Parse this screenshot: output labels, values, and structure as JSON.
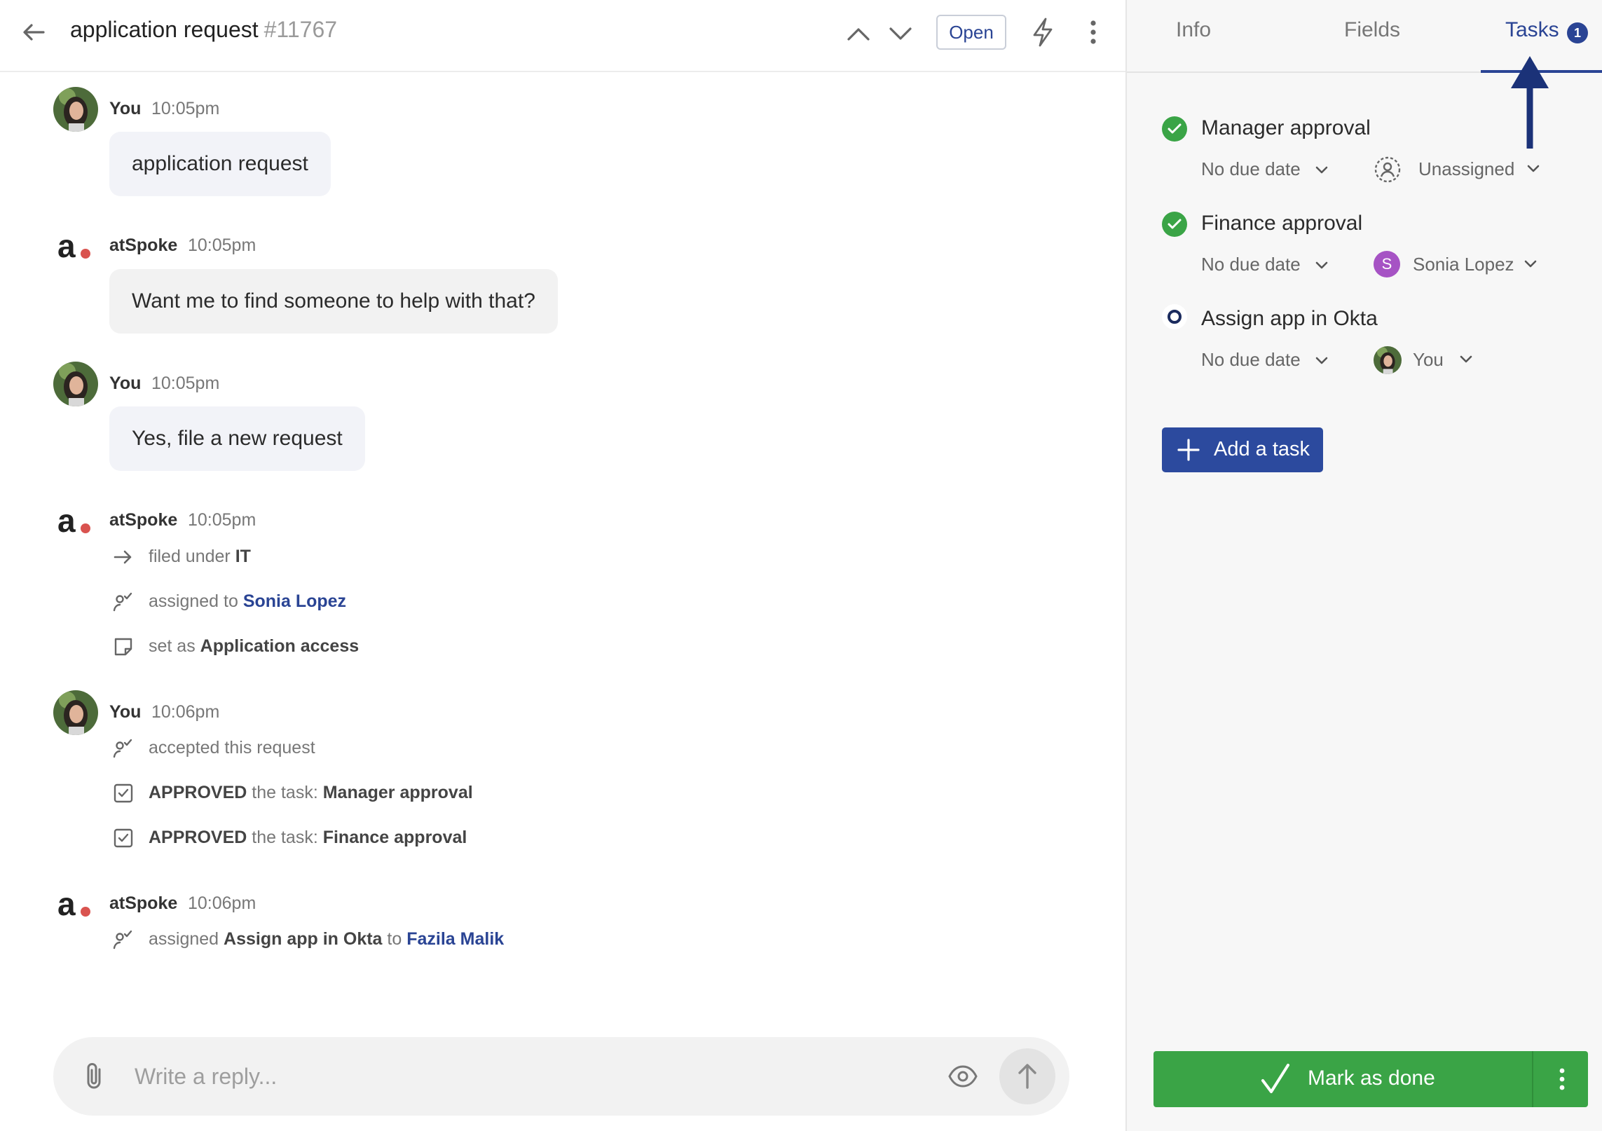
{
  "header": {
    "title": "application request",
    "ticket_number": "#11767",
    "status": "Open"
  },
  "messages": [
    {
      "author": "You",
      "time": "10:05pm",
      "text": "application request"
    },
    {
      "author": "atSpoke",
      "time": "10:05pm",
      "text": "Want me to find someone to help with that?"
    },
    {
      "author": "You",
      "time": "10:05pm",
      "text": "Yes, file a new request"
    },
    {
      "author": "atSpoke",
      "time": "10:05pm",
      "events": [
        {
          "prefix": "filed under",
          "value": "IT"
        },
        {
          "prefix": "assigned to",
          "value": "Sonia Lopez"
        },
        {
          "prefix": "set as",
          "value": "Application access"
        }
      ]
    },
    {
      "author": "You",
      "time": "10:06pm",
      "events": [
        {
          "text": "accepted this request"
        },
        {
          "action": "APPROVED",
          "mid": "the task:",
          "value": "Manager approval"
        },
        {
          "action": "APPROVED",
          "mid": "the task:",
          "value": "Finance approval"
        }
      ]
    },
    {
      "author": "atSpoke",
      "time": "10:06pm",
      "events": [
        {
          "prefix": "assigned",
          "task": "Assign app in Okta",
          "mid": "to",
          "value": "Fazila Malik"
        }
      ]
    }
  ],
  "composer": {
    "placeholder": "Write a reply..."
  },
  "panel": {
    "tabs": [
      {
        "label": "Info"
      },
      {
        "label": "Fields"
      },
      {
        "label": "Tasks",
        "badge": "1",
        "active": true
      }
    ],
    "tasks": [
      {
        "title": "Manager approval",
        "due": "No due date",
        "assignee": "Unassigned",
        "done": true
      },
      {
        "title": "Finance approval",
        "due": "No due date",
        "assignee": "Sonia Lopez",
        "assignee_initial": "S",
        "done": true
      },
      {
        "title": "Assign app in Okta",
        "due": "No due date",
        "assignee": "You",
        "done": false
      }
    ],
    "add_task_label": "Add a task",
    "mark_done_label": "Mark as done"
  },
  "colors": {
    "accent": "#2a4494",
    "success": "#3aa446",
    "logo_dot": "#d9534f"
  }
}
